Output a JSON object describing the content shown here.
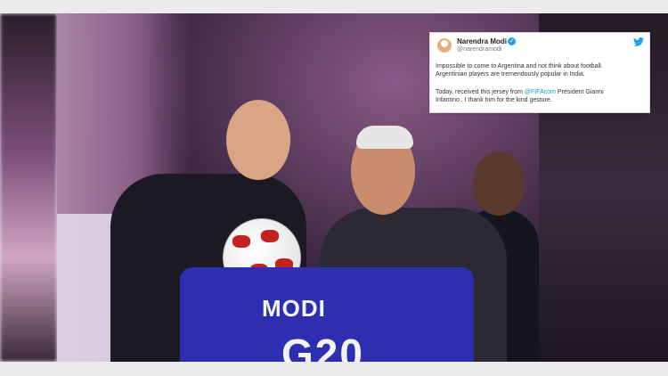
{
  "tweet": {
    "author": "Narendra Modi",
    "handle": "@narendramodi",
    "line1": "Impossible to come to Argentina and not think about football.",
    "line2": "Argentinian players are tremendously popular in India.",
    "line3_prefix": "Today, received this jersey from ",
    "line3_link": "@FIFAcom",
    "line3_suffix": " President Gianni",
    "line4": "Infantino . I thank him for the kind gesture."
  },
  "jersey": {
    "name": "MODI",
    "number": "G20"
  },
  "colors": {
    "twitter_blue": "#1da1f2",
    "jersey_blue": "#2d2fb0"
  },
  "icons": {
    "verified": "verified-badge-icon",
    "platform": "twitter-bird-icon"
  }
}
